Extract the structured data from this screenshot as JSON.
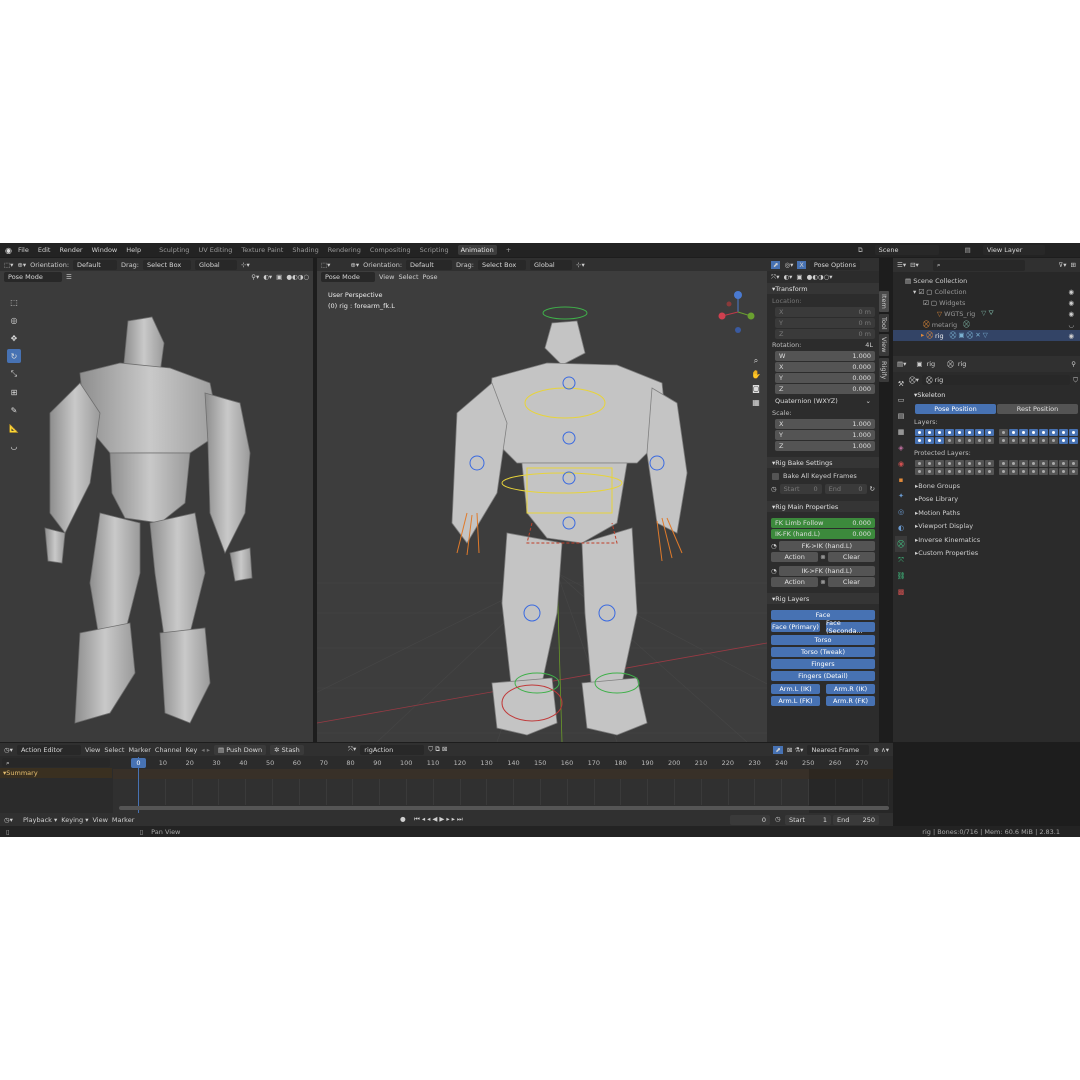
{
  "menu": {
    "items": [
      "File",
      "Edit",
      "Render",
      "Window",
      "Help"
    ],
    "workspaces": [
      "Sculpting",
      "UV Editing",
      "Texture Paint",
      "Shading",
      "Rendering",
      "Compositing",
      "Scripting",
      "Animation"
    ],
    "active_workspace": "Animation",
    "add_tab": "+",
    "scene": "Scene",
    "view_layer": "View Layer"
  },
  "left_view": {
    "orientation_label": "Orientation:",
    "orientation_value": "Default",
    "drag_label": "Drag:",
    "drag_value": "Select Box",
    "transform_space": "Global",
    "mode": "Pose Mode"
  },
  "main_view": {
    "mode": "Pose Mode",
    "menus": [
      "View",
      "Select",
      "Pose"
    ],
    "orientation_label": "Orientation:",
    "orientation_value": "Default",
    "drag_label": "Drag:",
    "drag_value": "Select Box",
    "transform_space": "Global",
    "pose_options": "Pose Options",
    "perspective": "User Perspective",
    "active_bone": "(0) rig : forearm_fk.L"
  },
  "sidebar": {
    "tabs": [
      "Item",
      "Tool",
      "View",
      "Rigify"
    ],
    "transform": {
      "title": "Transform",
      "location_label": "Location:",
      "location": [
        {
          "axis": "X",
          "value": "0 m"
        },
        {
          "axis": "Y",
          "value": "0 m"
        },
        {
          "axis": "Z",
          "value": "0 m"
        }
      ],
      "rotation_label": "Rotation:",
      "rotation_mode_short": "4L",
      "rotation": [
        {
          "axis": "W",
          "value": "1.000"
        },
        {
          "axis": "X",
          "value": "0.000"
        },
        {
          "axis": "Y",
          "value": "0.000"
        },
        {
          "axis": "Z",
          "value": "0.000"
        }
      ],
      "rotation_mode": "Quaternion (WXYZ)",
      "scale_label": "Scale:",
      "scale": [
        {
          "axis": "X",
          "value": "1.000"
        },
        {
          "axis": "Y",
          "value": "1.000"
        },
        {
          "axis": "Z",
          "value": "1.000"
        }
      ]
    },
    "bake": {
      "title": "Rig Bake Settings",
      "checkbox": "Bake All Keyed Frames",
      "start_label": "Start",
      "start_value": "0",
      "end_label": "End",
      "end_value": "0"
    },
    "main_props": {
      "title": "Rig Main Properties",
      "fk_limb_follow_label": "FK Limb Follow",
      "fk_limb_follow_value": "0.000",
      "ik_fk_label": "IK-FK (hand.L)",
      "ik_fk_value": "0.000",
      "fk_to_ik": "FK->IK (hand.L)",
      "ik_to_fk": "IK->FK (hand.L)",
      "action": "Action",
      "clear": "Clear"
    },
    "rig_layers": {
      "title": "Rig Layers",
      "rows": [
        [
          "Face"
        ],
        [
          "Face (Primary)",
          "Face (Seconda..."
        ],
        [
          "Torso"
        ],
        [
          "Torso (Tweak)"
        ],
        [
          "Fingers"
        ],
        [
          "Fingers (Detail)"
        ],
        [
          "Arm.L (IK)",
          "Arm.R (IK)"
        ],
        [
          "Arm.L (FK)",
          "Arm.R (FK)"
        ]
      ]
    }
  },
  "outliner": {
    "search_placeholder": "",
    "items": [
      "Scene Collection",
      "Collection",
      "Widgets",
      "WGTS_rig",
      "metarig",
      "rig"
    ]
  },
  "properties": {
    "object_name": "rig",
    "data_name": "rig",
    "armature_name": "rig",
    "skeleton_title": "Skeleton",
    "pose_position": "Pose Position",
    "rest_position": "Rest Position",
    "layers_label": "Layers:",
    "protected_layers_label": "Protected Layers:",
    "panels": [
      "Bone Groups",
      "Pose Library",
      "Motion Paths",
      "Viewport Display",
      "Inverse Kinematics",
      "Custom Properties"
    ]
  },
  "action_editor": {
    "mode": "Action Editor",
    "menus": [
      "View",
      "Select",
      "Marker",
      "Channel",
      "Key"
    ],
    "push_down": "Push Down",
    "stash": "Stash",
    "action_name": "rigAction",
    "snap": "Nearest Frame",
    "summary": "Summary",
    "current_frame_badge": "0",
    "ticks": [
      "0",
      "10",
      "20",
      "30",
      "40",
      "50",
      "60",
      "70",
      "80",
      "90",
      "100",
      "110",
      "120",
      "130",
      "140",
      "150",
      "160",
      "170",
      "180",
      "190",
      "200",
      "210",
      "220",
      "230",
      "240",
      "250",
      "260",
      "270"
    ]
  },
  "playback": {
    "menus": [
      "Playback",
      "Keying",
      "View",
      "Marker"
    ],
    "current_frame": "0",
    "start_label": "Start",
    "start_value": "1",
    "end_label": "End",
    "end_value": "250"
  },
  "statusbar": {
    "hint": "Pan View",
    "stats": "rig | Bones:0/716 | Mem: 60.6 MiB | 2.83.1"
  }
}
